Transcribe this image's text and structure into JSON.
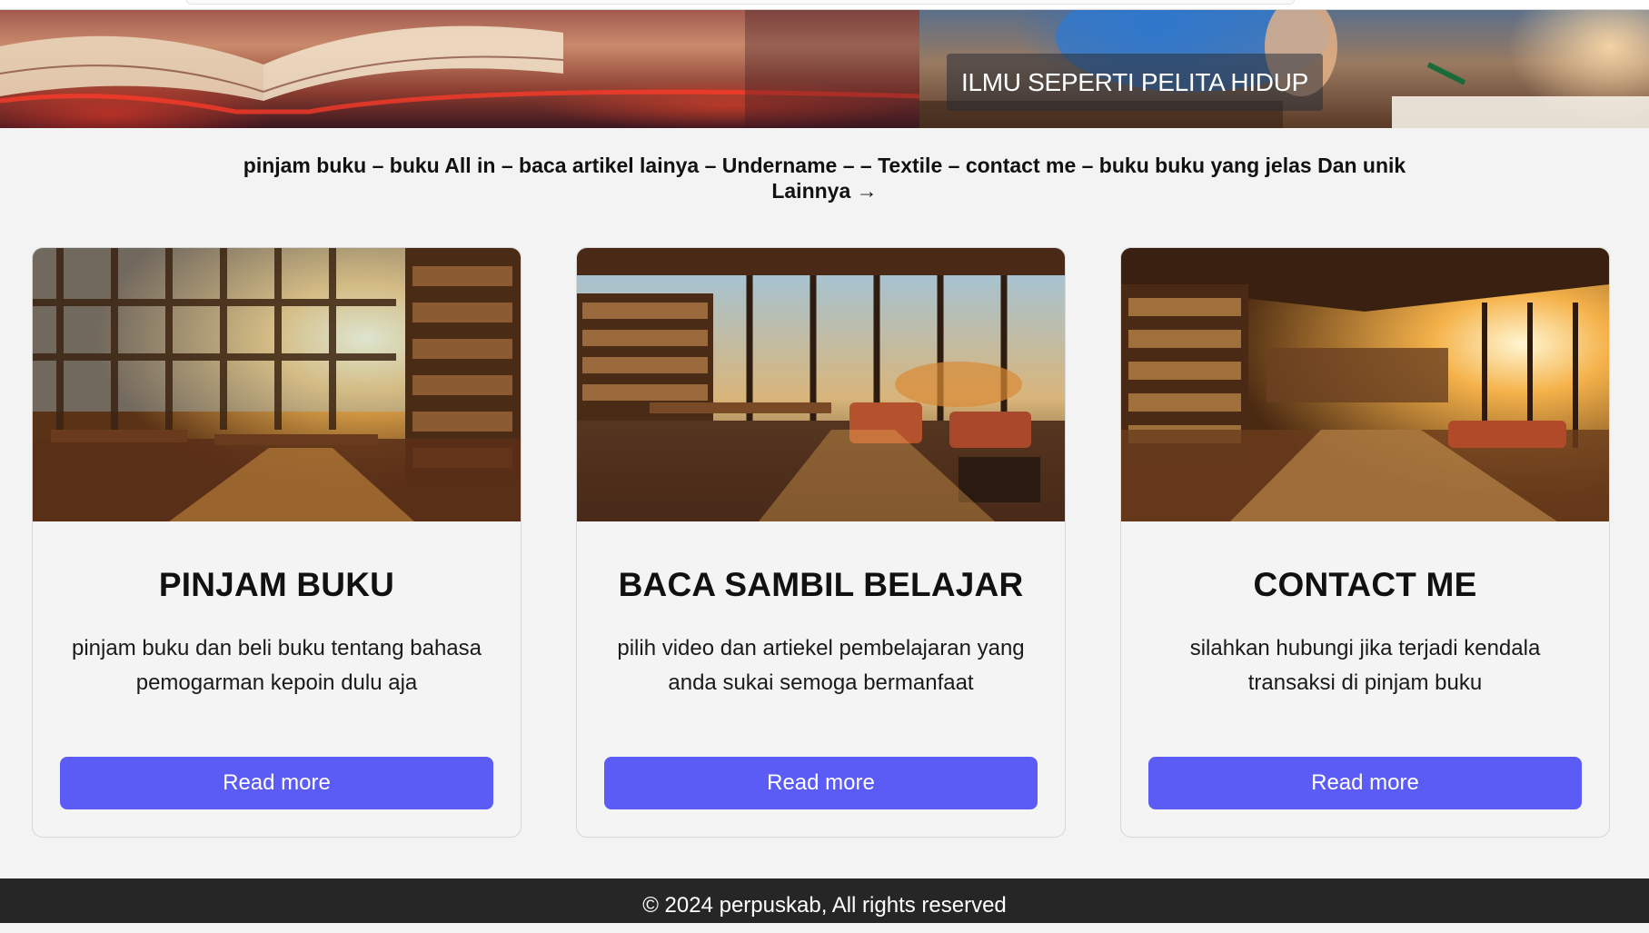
{
  "banner": {
    "caption": "ILMU SEPERTI PELITA HIDUP"
  },
  "nav": {
    "line1": "pinjam buku – buku All in – baca artikel lainya – Undername – – Textile – contact me – buku buku yang jelas Dan unik",
    "line2": "Lainnya →"
  },
  "cards": [
    {
      "title": "PINJAM BUKU",
      "description": "pinjam buku dan beli buku tentang bahasa pemogarman kepoin dulu aja",
      "button": "Read more"
    },
    {
      "title": "BACA SAMBIL BELAJAR",
      "description": "pilih video dan artiekel pembelajaran yang anda sukai semoga bermanfaat",
      "button": "Read more"
    },
    {
      "title": "CONTACT ME",
      "description": "silahkan hubungi jika terjadi kendala transaksi di pinjam buku",
      "button": "Read more"
    }
  ],
  "footer": {
    "text": "© 2024 perpuskab, All rights reserved"
  },
  "colors": {
    "background": "#f3f3f3",
    "button": "#5b5cf6",
    "footer": "#262626"
  }
}
